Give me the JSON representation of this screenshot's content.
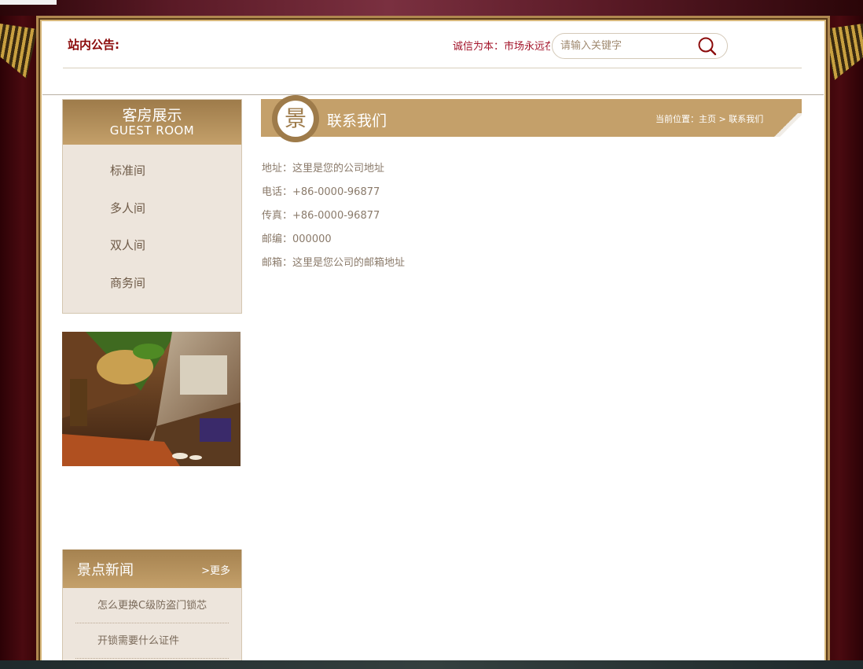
{
  "header": {
    "notice_label": "站内公告:",
    "notice_text": "诚信为本：市场永远在变，诚信永远不变。",
    "search": {
      "placeholder": "请输入关键字",
      "icon": "search-icon"
    }
  },
  "sidebar": {
    "guest_room": {
      "title_cn": "客房展示",
      "title_en": "GUEST ROOM",
      "items": [
        "标准间",
        "多人间",
        "双人间",
        "商务间"
      ]
    },
    "news": {
      "title": "景点新闻",
      "more_label": ">更多",
      "items": [
        "怎么更换C级防盗门锁芯",
        "开锁需要什么证件"
      ]
    }
  },
  "main": {
    "badge_char": "景",
    "title": "联系我们",
    "breadcrumb": {
      "prefix": "当前位置：",
      "home": "主页",
      "separator": " > ",
      "current": "联系我们"
    },
    "contact": [
      {
        "label": "地址：",
        "value": "这里是您的公司地址"
      },
      {
        "label": "电话：",
        "value": "+86-0000-96877"
      },
      {
        "label": "传真：",
        "value": "+86-0000-96877"
      },
      {
        "label": "邮编：",
        "value": "000000"
      },
      {
        "label": "邮箱：",
        "value": "这里是您公司的邮箱地址"
      }
    ]
  },
  "colors": {
    "accent_gold": "#c4a06a",
    "notice_red": "#8b0a0a",
    "sidebar_bg": "#ede5dc",
    "curtain": "#3a0508"
  }
}
